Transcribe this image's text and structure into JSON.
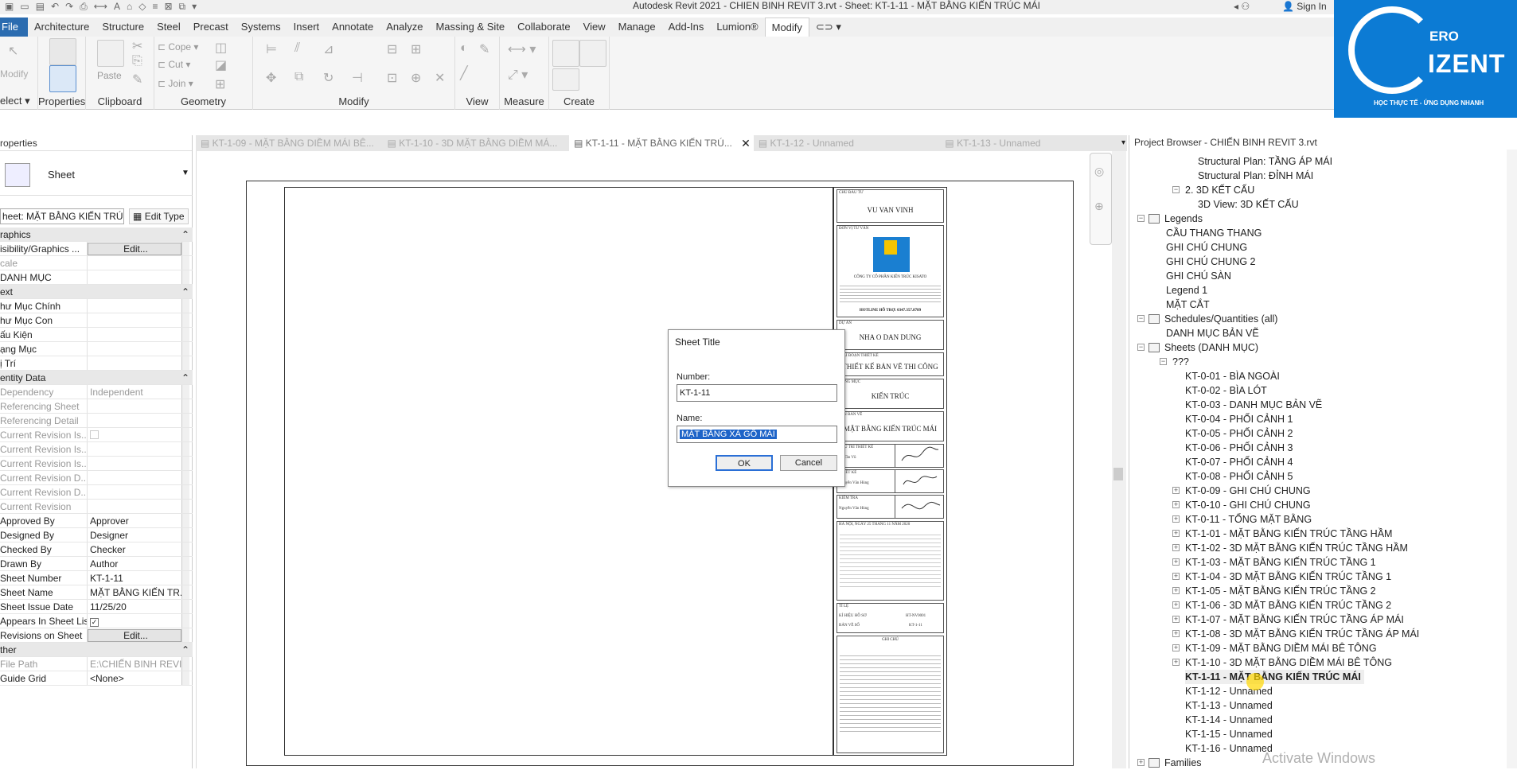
{
  "titlebar": {
    "title": "Autodesk Revit 2021 - CHIEN BINH REVIT 3.rvt - Sheet: KT-1-11 - MẶT BẰNG KIẾN TRÚC MÁI",
    "signin": "Sign In"
  },
  "ribbon_tabs": [
    "File",
    "Architecture",
    "Structure",
    "Steel",
    "Precast",
    "Systems",
    "Insert",
    "Annotate",
    "Analyze",
    "Massing & Site",
    "Collaborate",
    "View",
    "Manage",
    "Add-Ins",
    "Lumion®",
    "Modify"
  ],
  "ribbon_groups": {
    "select": "elect",
    "properties": "Properties",
    "clipboard": "Clipboard",
    "geometry": "Geometry",
    "modify": "Modify",
    "view": "View",
    "measure": "Measure",
    "create": "Create",
    "modify_btn": "Modify",
    "paste": "Paste",
    "cope": "Cope",
    "cut": "Cut",
    "join": "Join"
  },
  "logo": {
    "line1": "ERO",
    "line2": "IZENT",
    "line3": "HỌC THỰC TẾ - ỨNG DỤNG NHANH"
  },
  "properties": {
    "title": "roperties",
    "type_name": "Sheet",
    "selector": "heet: MẶT BẰNG KIẾN TRÚ",
    "edit_type": "Edit Type",
    "rows": [
      {
        "k": "raphics",
        "cat": true
      },
      {
        "k": "isibility/Graphics ...",
        "v": "Edit...",
        "btn": true
      },
      {
        "k": "cale",
        "v": "",
        "grey": true
      },
      {
        "k": "DANH MỤC",
        "v": ""
      },
      {
        "k": "ext",
        "cat": true
      },
      {
        "k": "hư Mục Chính",
        "v": ""
      },
      {
        "k": "hư Mục Con",
        "v": ""
      },
      {
        "k": "ấu Kiện",
        "v": ""
      },
      {
        "k": "ạng Mục",
        "v": ""
      },
      {
        "k": "ị Trí",
        "v": ""
      },
      {
        "k": "entity Data",
        "cat": true
      },
      {
        "k": "Dependency",
        "v": "Independent",
        "grey": true
      },
      {
        "k": "Referencing Sheet",
        "v": "",
        "grey": true
      },
      {
        "k": "Referencing Detail",
        "v": "",
        "grey": true
      },
      {
        "k": "Current Revision Is...",
        "v": "",
        "grey": true,
        "chk": "dis"
      },
      {
        "k": "Current Revision Is...",
        "v": "",
        "grey": true
      },
      {
        "k": "Current Revision Is...",
        "v": "",
        "grey": true
      },
      {
        "k": "Current Revision D...",
        "v": "",
        "grey": true
      },
      {
        "k": "Current Revision D...",
        "v": "",
        "grey": true
      },
      {
        "k": "Current Revision",
        "v": "",
        "grey": true
      },
      {
        "k": "Approved By",
        "v": "Approver"
      },
      {
        "k": "Designed By",
        "v": "Designer"
      },
      {
        "k": "Checked By",
        "v": "Checker"
      },
      {
        "k": "Drawn By",
        "v": "Author"
      },
      {
        "k": "Sheet Number",
        "v": "KT-1-11"
      },
      {
        "k": "Sheet Name",
        "v": "MẶT BẰNG KIẾN TR..."
      },
      {
        "k": "Sheet Issue Date",
        "v": "11/25/20"
      },
      {
        "k": "Appears In Sheet List",
        "v": "",
        "chk": "on"
      },
      {
        "k": "Revisions on Sheet",
        "v": "Edit...",
        "btn": true
      },
      {
        "k": "ther",
        "cat": true
      },
      {
        "k": "File Path",
        "v": "E:\\CHIẾN BINH REVI...",
        "grey": true
      },
      {
        "k": "Guide Grid",
        "v": "<None>"
      }
    ]
  },
  "doc_tabs": [
    "KT-1-09 - MẶT BẰNG DIỀM MÁI BÊ...",
    "KT-1-10 - 3D MẶT BẰNG DIỀM MÁ...",
    "KT-1-11 - MẶT BẰNG KIẾN TRÚ...",
    "KT-1-12 - Unnamed",
    "KT-1-13 - Unnamed"
  ],
  "titleblock": {
    "owner_label": "CHỦ ĐẦU TƯ",
    "owner": "VU VAN VINH",
    "consultant_label": "ĐƠN VỊ TƯ VẤN",
    "company": "CÔNG TY CỔ PHẦN KIẾN TRÚC KISATO",
    "hotline": "HOTLINE HỖ TRỢ: 0347.357.8789",
    "project_label": "DỰ ÁN",
    "project": "NHA O DAN DUNG",
    "phase_label": "GIAI ĐOẠN THIẾT KẾ",
    "phase": "THIẾT KẾ BẢN VẼ THI CÔNG",
    "item_label": "HẠNG MỤC",
    "item": "KIẾN TRÚC",
    "sheet_label": "TÊN BẢN VẼ",
    "sheet": "MẶT BẰNG KIẾN TRÚC MÁI",
    "sig1": "CHỦ TRÌ THIẾT KẾ",
    "sig1n": "Lê Tần Vũ",
    "sig2": "THIẾT KẾ",
    "sig2n": "Nguyễn Văn Hùng",
    "sig3": "KIỂM TRA",
    "sig3n": "Nguyễn Văn Hùng",
    "date": "HÀ NỘI, NGÀY 25 THÁNG 11 NĂM 2020",
    "scale": "TỈ LỆ",
    "code_label": "KÍ HIỆU HỒ SƠ",
    "code": "HT-NV0001",
    "sheetno_label": "BẢN VẼ SỐ",
    "sheetno": "KT-1-11",
    "note": "GHI CHÚ"
  },
  "dialog": {
    "title": "Sheet Title",
    "number_label": "Number:",
    "number": "KT-1-11",
    "name_label": "Name:",
    "name": "MẶT BẰNG XÀ GỒ MÁI",
    "ok": "OK",
    "cancel": "Cancel"
  },
  "browser": {
    "title": "Project Browser - CHIẾN BINH REVIT 3.rvt",
    "watermark": "Activate Windows"
  }
}
